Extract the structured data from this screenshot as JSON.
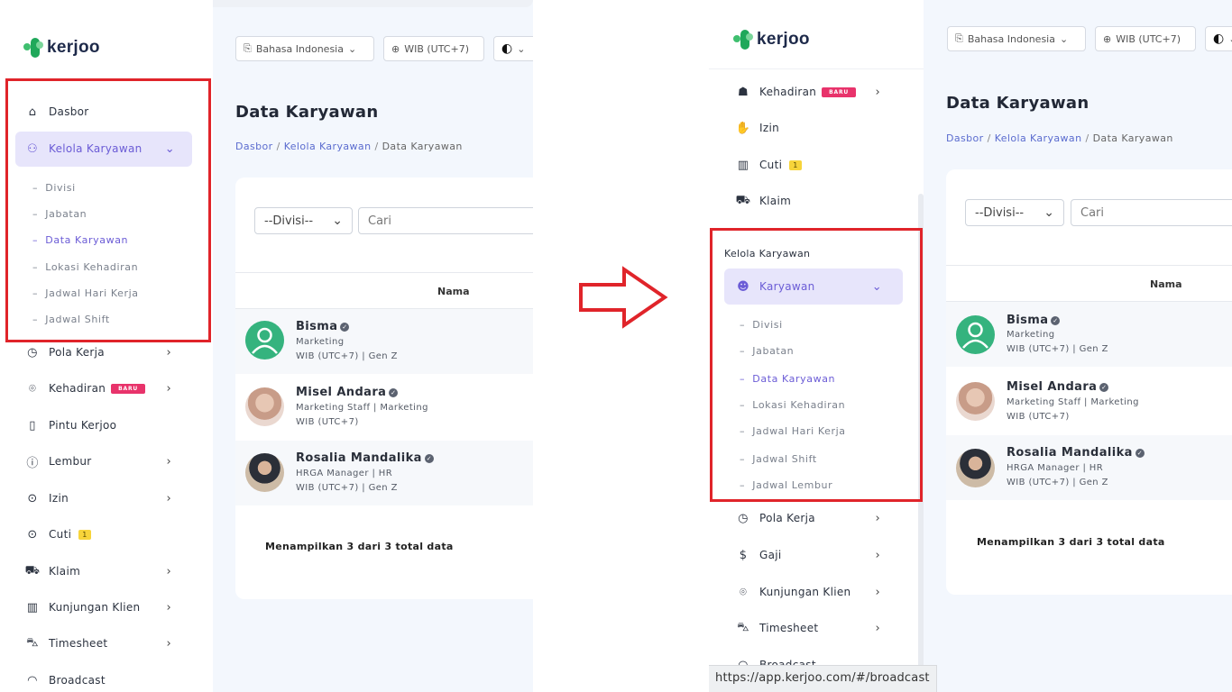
{
  "brand": {
    "name": "kerjoo"
  },
  "topbar": {
    "language": "Bahasa Indonesia",
    "timezone": "WIB (UTC+7)"
  },
  "page": {
    "title": "Data Karyawan",
    "breadcrumb": [
      "Dasbor",
      "Kelola Karyawan",
      "Data Karyawan"
    ]
  },
  "filters": {
    "division_select": "--Divisi--",
    "search_placeholder": "Cari"
  },
  "table": {
    "header_name": "Nama"
  },
  "employees_left": [
    {
      "name": "Bisma",
      "line1": "Marketing",
      "line2": "WIB (UTC+7) | Gen Z"
    },
    {
      "name": "Misel Andara",
      "line1": "Marketing Staff | Marketing",
      "line2": "WIB (UTC+7)"
    },
    {
      "name": "Rosalia Mandalika",
      "line1": "HRGA Manager | HR",
      "line2": "WIB (UTC+7) | Gen Z"
    }
  ],
  "employees_right": [
    {
      "name": "Bisma",
      "line1": "Marketing",
      "line2": "WIB (UTC+7) | Gen Z"
    },
    {
      "name": "Misel Andara",
      "line1": "Marketing Staff | Marketing",
      "line2": "WIB (UTC+7)"
    },
    {
      "name": "Rosalia Mandalika",
      "line1": "HRGA Manager | HR",
      "line2": "WIB (UTC+7) | Gen Z"
    }
  ],
  "summary": "Menampilkan 3 dari 3 total data",
  "left_sidebar": {
    "dasbor": "Dasbor",
    "kelola_karyawan": "Kelola Karyawan",
    "sub": [
      "Divisi",
      "Jabatan",
      "Data Karyawan",
      "Lokasi Kehadiran",
      "Jadwal Hari Kerja",
      "Jadwal Shift"
    ],
    "items": [
      "Pola Kerja",
      "Kehadiran",
      "Pintu Kerjoo",
      "Lembur",
      "Izin",
      "Cuti",
      "Klaim",
      "Kunjungan Klien",
      "Timesheet",
      "Broadcast"
    ],
    "badge_new": "BARU",
    "cuti_count": "1"
  },
  "right_sidebar": {
    "top_items": [
      "Kehadiran",
      "Izin",
      "Cuti",
      "Klaim"
    ],
    "badge_new": "BARU",
    "cuti_count": "1",
    "section_title": "Kelola Karyawan",
    "karyawan": "Karyawan",
    "sub": [
      "Divisi",
      "Jabatan",
      "Data Karyawan",
      "Lokasi Kehadiran",
      "Jadwal Hari Kerja",
      "Jadwal Shift",
      "Jadwal Lembur"
    ],
    "items": [
      "Pola Kerja",
      "Gaji",
      "Kunjungan Klien",
      "Timesheet",
      "Broadcast"
    ]
  },
  "status_bar": {
    "url": "https://app.kerjoo.com/#/broadcast"
  },
  "colors": {
    "accent": "#6b5cd6",
    "highlight": "#e0242a",
    "badge_new": "#e8336b",
    "arrow": "#e0242a"
  }
}
